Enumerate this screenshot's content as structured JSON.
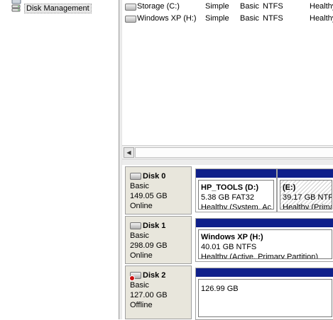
{
  "tree": {
    "items": [
      {
        "label": "Disk Management",
        "icon": "disk-management-icon",
        "selected": true
      }
    ]
  },
  "volumes": {
    "rows": [
      {
        "volume": "Storage (C:)",
        "layout": "Simple",
        "type": "Basic",
        "fs": "NTFS",
        "status": "Healthy"
      },
      {
        "volume": "Windows XP (H:)",
        "layout": "Simple",
        "type": "Basic",
        "fs": "NTFS",
        "status": "Healthy"
      }
    ]
  },
  "scrollbar": {
    "left_arrow": "◀"
  },
  "disks": [
    {
      "name": "Disk 0",
      "type": "Basic",
      "size": "149.05 GB",
      "status": "Online",
      "partitions": [
        {
          "title": "HP_TOOLS  (D:)",
          "detail": "5.38 GB FAT32",
          "state": "Healthy (System, Ac"
        },
        {
          "title": "(E:)",
          "detail": "39.17 GB NTFS",
          "state": "Healthy (Prima"
        }
      ]
    },
    {
      "name": "Disk 1",
      "type": "Basic",
      "size": "298.09 GB",
      "status": "Online",
      "partitions": [
        {
          "title": "Windows XP  (H:)",
          "detail": "40.01 GB NTFS",
          "state": "Healthy (Active, Primary Partition)"
        }
      ]
    },
    {
      "name": "Disk 2",
      "type": "Basic",
      "size": "127.00 GB",
      "status": "Offline",
      "partitions": [
        {
          "title": "",
          "detail": "126.99 GB",
          "state": ""
        }
      ]
    }
  ]
}
